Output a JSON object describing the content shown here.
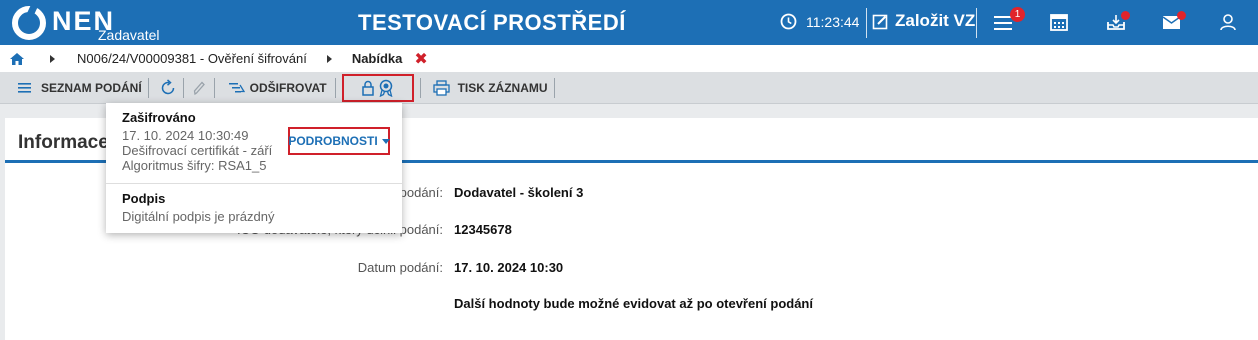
{
  "app": {
    "logo_text": "NEN",
    "logo_sub": "Zadavatel",
    "env_title": "TESTOVACÍ PROSTŘEDÍ",
    "clock": "11:23:44",
    "create_vz": "Založit VZ",
    "menu_badge": "1",
    "icons": [
      "clock-icon",
      "edit-icon",
      "menu-icon",
      "calendar-icon",
      "inbox-icon",
      "mail-icon",
      "user-icon"
    ]
  },
  "breadcrumb": {
    "item": "N006/24/V00009381 - Ověření šifrování",
    "current": "Nabídka",
    "close": "✖"
  },
  "toolbar": {
    "list": "SEZNAM PODÁNÍ",
    "decrypt": "ODŠIFROVAT",
    "print": "TISK ZÁZNAMU"
  },
  "panel": {
    "title": "Informace",
    "rows": [
      {
        "label": "podání:",
        "value": "Dodavatel - školení 3"
      },
      {
        "label": "IČO dodavatele, který učinil podání:",
        "value": "12345678"
      },
      {
        "label": "Datum podání:",
        "value": "17. 10. 2024 10:30"
      },
      {
        "label": "",
        "value": "Další hodnoty bude možné evidovat až po otevření podání"
      }
    ]
  },
  "popup": {
    "enc_title": "Zašifrováno",
    "enc_date": "17. 10. 2024 10:30:49",
    "enc_cert": "Dešifrovací certifikát - září",
    "enc_alg": "Algoritmus šifry: RSA1_5",
    "details_btn": "PODROBNOSTI",
    "sig_title": "Podpis",
    "sig_text": "Digitální podpis je prázdný"
  },
  "colors": {
    "brand": "#1d6fb5",
    "alert": "#d0202a"
  }
}
